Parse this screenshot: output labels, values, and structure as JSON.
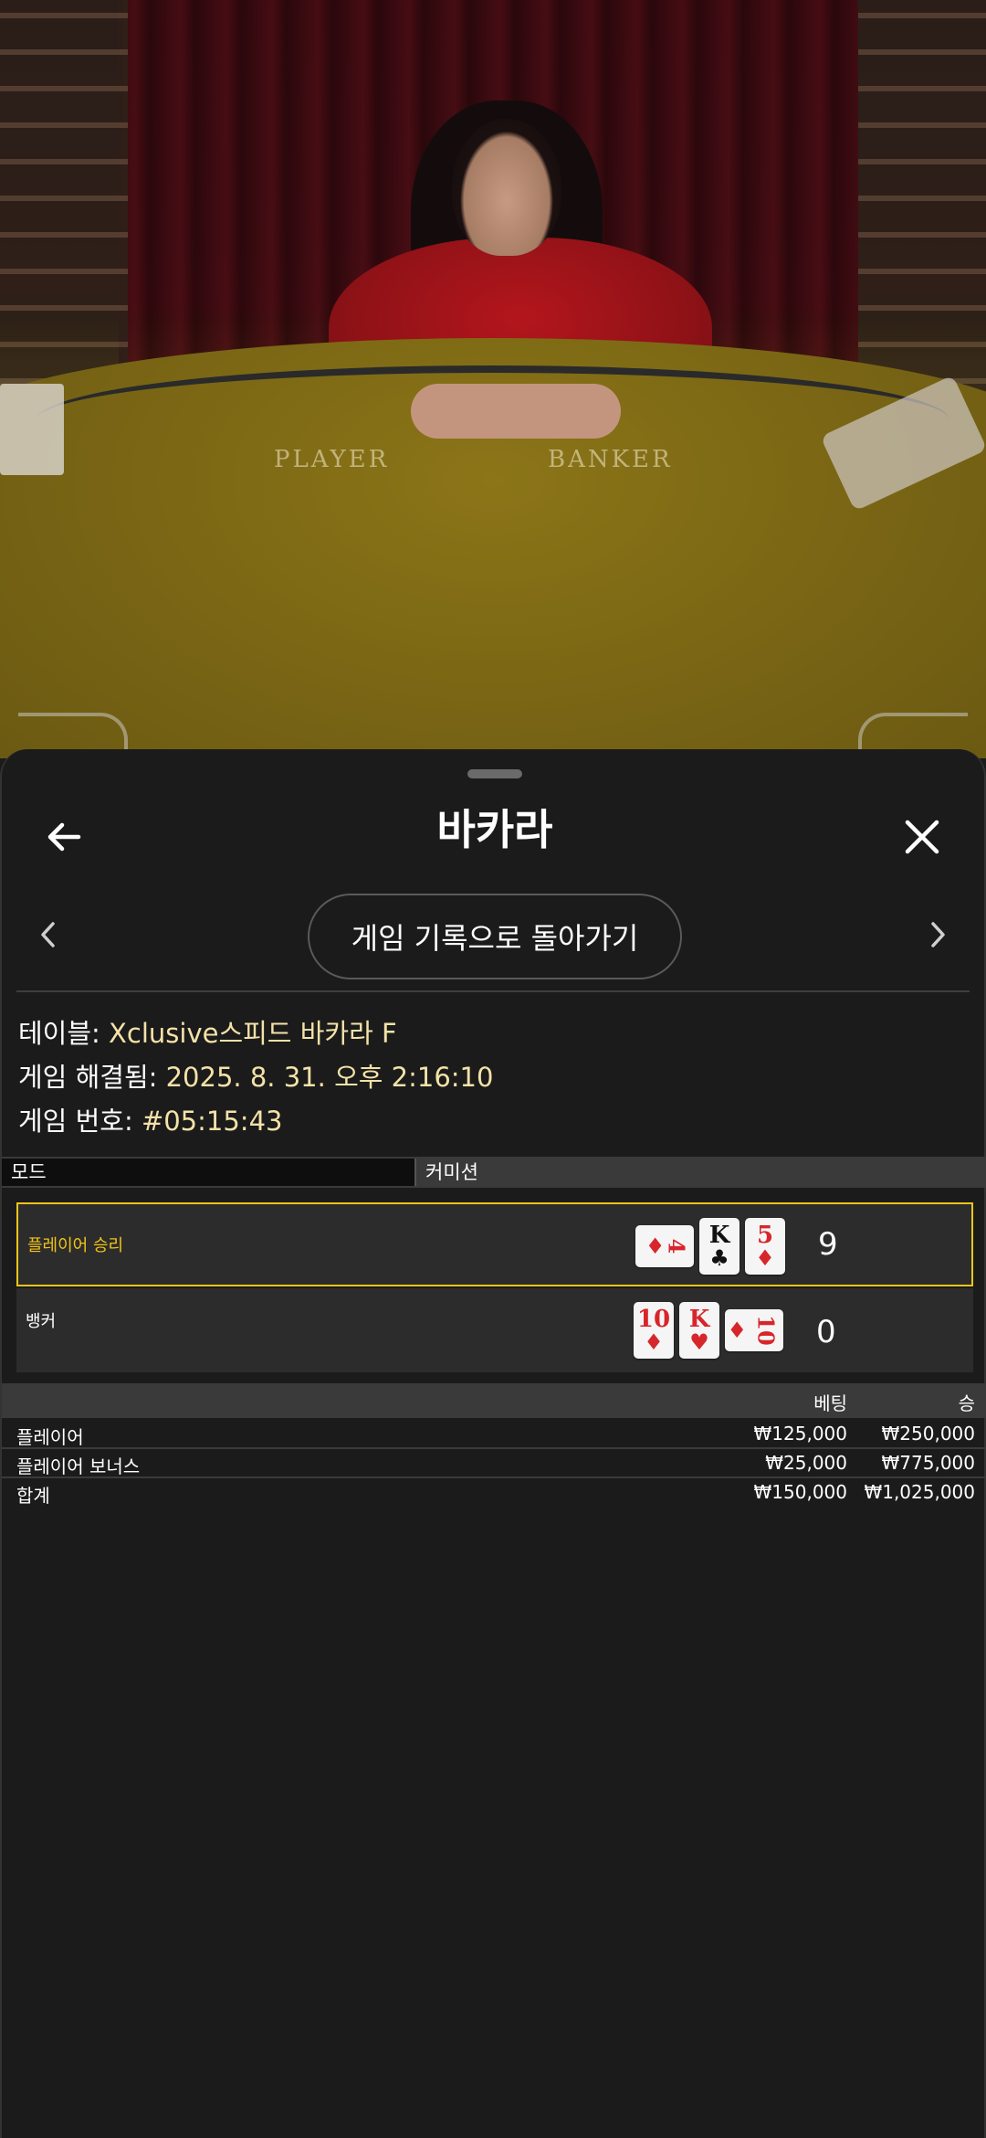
{
  "video": {
    "table_text_player": "PLAYER",
    "table_text_banker": "BANKER"
  },
  "header": {
    "title": "바카라",
    "back_icon": "arrow-left-icon",
    "close_icon": "close-icon"
  },
  "nav": {
    "history_button": "게임 기록으로 돌아가기",
    "prev_icon": "chevron-left-icon",
    "next_icon": "chevron-right-icon"
  },
  "info": {
    "table_label": "테이블:",
    "table_value": "Xclusive스피드 바카라 F",
    "resolved_label": "게임 해결됨:",
    "resolved_value": "2025. 8. 31. 오후 2:16:10",
    "game_label": "게임 번호:",
    "game_value": "#05:15:43"
  },
  "mode_bar": {
    "mode": "모드",
    "commission": "커미션"
  },
  "results": {
    "player": {
      "label": "플레이어 승리",
      "cards": [
        {
          "rank": "4",
          "suit": "♦",
          "color": "red",
          "orientation": "side"
        },
        {
          "rank": "K",
          "suit": "♣",
          "color": "black",
          "orientation": "up"
        },
        {
          "rank": "5",
          "suit": "♦",
          "color": "red",
          "orientation": "up"
        }
      ],
      "score": "9"
    },
    "banker": {
      "label": "뱅커",
      "cards": [
        {
          "rank": "10",
          "suit": "♦",
          "color": "red",
          "orientation": "up"
        },
        {
          "rank": "K",
          "suit": "♥",
          "color": "red",
          "orientation": "up"
        },
        {
          "rank": "10",
          "suit": "♦",
          "color": "red",
          "orientation": "side"
        }
      ],
      "score": "0"
    }
  },
  "bets": {
    "headers": {
      "bet": "베팅",
      "win": "승"
    },
    "rows": [
      {
        "name": "플레이어",
        "bet": "₩125,000",
        "win": "₩250,000"
      },
      {
        "name": "플레이어 보너스",
        "bet": "₩25,000",
        "win": "₩775,000"
      }
    ],
    "total": {
      "name": "합계",
      "bet": "₩150,000",
      "win": "₩1,025,000"
    }
  },
  "colors": {
    "accent": "#f0c419",
    "info_value": "#f4e2a8",
    "card_red": "#d7262b",
    "sheet_bg": "#1b1b1b"
  }
}
